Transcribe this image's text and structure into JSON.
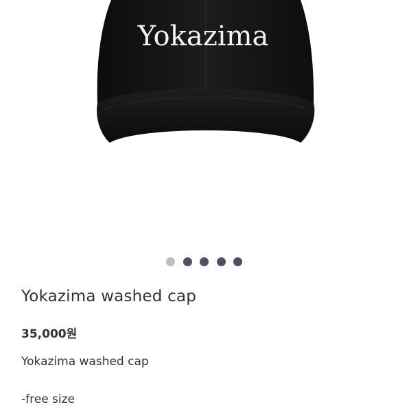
{
  "image": {
    "embroidery_text": "Yokazima",
    "cap_color": "#141414",
    "thread_color": "#f2f2f2"
  },
  "carousel": {
    "dot_count": 5,
    "active_index": 0,
    "active_color": "#bdbdbd",
    "inactive_color": "#4b5263"
  },
  "product": {
    "title": "Yokazima washed cap",
    "price": "35,000원",
    "description": "Yokazima washed cap",
    "size": "-free size"
  }
}
